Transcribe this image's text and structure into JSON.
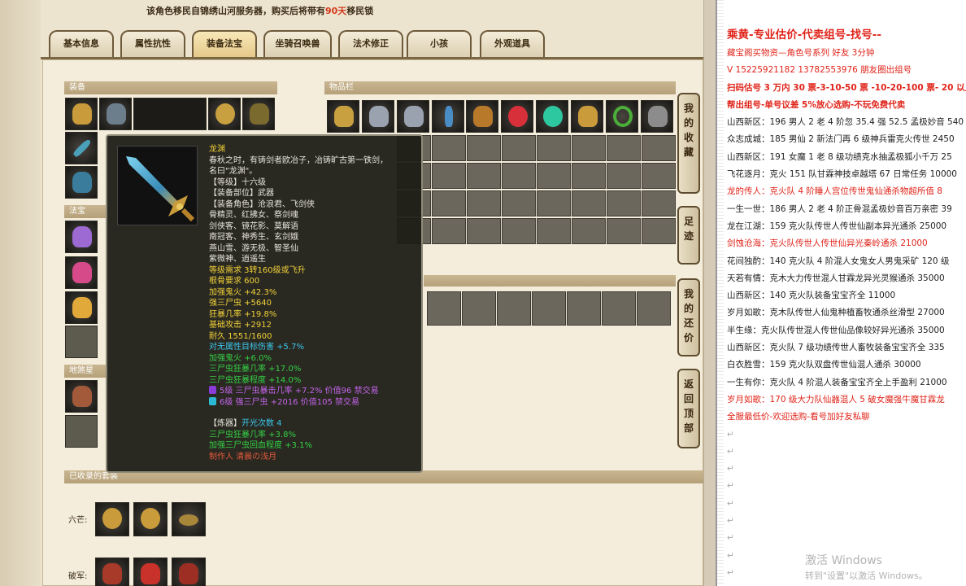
{
  "notice": {
    "prefix": "该角色移民自锦绣山河服务器，购买后将带有",
    "days": "90天",
    "suffix": "移民锁"
  },
  "tabs": [
    "基本信息",
    "属性抗性",
    "装备法宝",
    "坐骑召唤兽",
    "法术修正",
    "小孩",
    "外观道具"
  ],
  "active_tab": "装备法宝",
  "sections": {
    "equipment": "装备",
    "inventory": "物品栏",
    "fabao": "法宝",
    "dishazhu": "地煞星",
    "collected": "已收录的套装"
  },
  "right_buttons": [
    "我的收藏",
    "足迹",
    "我的还价",
    "返回顶部"
  ],
  "collected_rows": [
    "六芒:",
    "破军:"
  ],
  "tooltip": {
    "name": "龙渊",
    "lines": [
      {
        "t": "春秋之时，有铸剑者欧冶子，冶铸旷古第一铁剑，",
        "c": ""
      },
      {
        "t": "名曰\"龙渊\"。",
        "c": ""
      },
      {
        "t": "【等级】十六级",
        "c": ""
      },
      {
        "t": "【装备部位】武器",
        "c": ""
      },
      {
        "t": "【装备角色】沧浪君、飞剑侠",
        "c": ""
      },
      {
        "t": "骨精灵、红拂女、祭剑魂",
        "c": ""
      },
      {
        "t": "剑侠客、镜花影、莫解语",
        "c": ""
      },
      {
        "t": "南冠客、神秀生、玄剑娥",
        "c": ""
      },
      {
        "t": "燕山雪、游无极、智圣仙",
        "c": ""
      },
      {
        "t": "紫微神、逍遥生",
        "c": ""
      },
      {
        "t": "等级需求 3转160级或飞升",
        "c": "c-yellow"
      },
      {
        "t": "根骨要求 600",
        "c": "c-yellow"
      },
      {
        "t": "加强鬼火 +42.3%",
        "c": "c-yellow"
      },
      {
        "t": "强三尸虫 +5640",
        "c": "c-yellow"
      },
      {
        "t": "狂暴几率 +19.8%",
        "c": "c-yellow"
      },
      {
        "t": "基础攻击 +2912",
        "c": "c-yellow"
      },
      {
        "t": "耐久 1551/1600",
        "c": "c-yellow"
      },
      {
        "t": "对无属性目标伤害 +5.7%",
        "c": "c-cyan"
      },
      {
        "t": "加强鬼火 +6.0%",
        "c": "c-green"
      },
      {
        "t": "三尸虫狂暴几率 +17.0%",
        "c": "c-green"
      },
      {
        "t": "三尸虫狂暴程度 +14.0%",
        "c": "c-green"
      }
    ],
    "gems": [
      {
        "t": "5级 三尸虫暴击几率 +7.2% 价值96 禁交易",
        "c": "c-purple",
        "gem": "#8a3cd8"
      },
      {
        "t": "6级 强三尸虫 +2016 价值105 禁交易",
        "c": "c-purple",
        "gem": "#2cb9d4"
      }
    ],
    "refine_label": "【炼器】",
    "refine_count": "开光次数 4",
    "refine_lines": [
      {
        "t": "三尸虫狂暴几率 +3.8%",
        "c": "c-green"
      },
      {
        "t": "加强三尸虫回血程度 +3.1%",
        "c": "c-green"
      }
    ],
    "maker": "制作人 清晨の浅月"
  },
  "chat": {
    "lines": [
      {
        "t": "乘黄-专业估价-代卖组号-找号--",
        "k": "head"
      },
      {
        "t": "藏宝阁买物资—角色号系列 好友 3分钟",
        "k": "red"
      },
      {
        "t": "V 15225921182   13782553976 朋友圈出组号",
        "k": "red"
      },
      {
        "t": "扫码估号 3 万内 30 票-3-10-50 票 -10-20-100 票- 20 以上",
        "k": "red bold"
      },
      {
        "t": "帮出组号-单号议差 5%放心选购-不玩免费代卖",
        "k": "red bold"
      },
      {
        "t": "山西新区：196 男人 2 老 4 阶忽 35.4 强 52.5 孟极妙音 540",
        "k": ""
      },
      {
        "t": "众志成城：185 男仙 2 新法门再 6 级神兵雷克火传世 2450",
        "k": ""
      },
      {
        "t": "山西新区：191 女魔 1 老 8 级功绩克水抽孟极狐小千万 25",
        "k": ""
      },
      {
        "t": "飞花逐月：克火 151 队甘霖神技卓越塔 67 日常任务 10000",
        "k": ""
      },
      {
        "t": "龙的传人：克火队 4 阶睡人宫位传世鬼仙通杀物超所值 8",
        "k": "red"
      },
      {
        "t": "一生一世：186 男人 2 老 4 阶正骨混孟极妙音百万亲密 39",
        "k": ""
      },
      {
        "t": "龙在江湖：159 克火队传世人传世仙副本异光通杀 25000",
        "k": ""
      },
      {
        "t": "剑蚀沧海：克火队传世人传世仙异光秦岭通杀 21000",
        "k": "red"
      },
      {
        "t": "花间独酌：140 克火队 4 阶混人女鬼女人男鬼采矿 120 级",
        "k": ""
      },
      {
        "t": "天若有情：克木大力传世混人甘霖龙异光灵猴通杀 35000",
        "k": ""
      },
      {
        "t": "山西新区：140 克火队装备宝宝齐全 11000",
        "k": ""
      },
      {
        "t": "岁月如歌：克木队传世人仙鬼种植畜牧通杀丝滑型 27000",
        "k": ""
      },
      {
        "t": "半生缘：克火队传世混人传世仙品像较好异光通杀 35000",
        "k": ""
      },
      {
        "t": "山西新区：克火队 7 级功绩传世人畜牧装备宝宝齐全 335",
        "k": ""
      },
      {
        "t": "白衣胜雪：159 克火队双盘传世仙混人通杀 30000",
        "k": ""
      },
      {
        "t": "一生有你：克火队 4 阶混人装备宝宝齐全上手盈利 21000",
        "k": ""
      },
      {
        "t": "岁月如歌：170 级大力队仙器混人 5 破女魔强牛魔甘霖龙",
        "k": "red"
      },
      {
        "t": "全服最低价-欢迎选购-看号加好友私聊",
        "k": "red"
      }
    ],
    "marks": [
      "↵",
      "↵",
      "↵",
      "↵",
      "↵",
      "↵",
      "↵",
      "↵",
      "↵"
    ]
  },
  "activate": {
    "title": "激活 Windows",
    "sub": "转到\"设置\"以激活 Windows。"
  },
  "colors": {
    "accent_red": "#e0241a",
    "tooltip_bg": "#1e1e16",
    "tab_border": "#6d5a3a"
  }
}
